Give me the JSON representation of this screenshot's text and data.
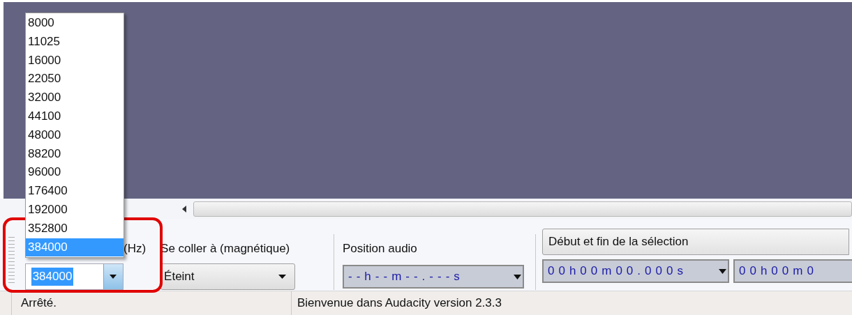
{
  "rate_dropdown": {
    "options": [
      {
        "label": "8000",
        "selected": false
      },
      {
        "label": "11025",
        "selected": false
      },
      {
        "label": "16000",
        "selected": false
      },
      {
        "label": "22050",
        "selected": false
      },
      {
        "label": "32000",
        "selected": false
      },
      {
        "label": "44100",
        "selected": false
      },
      {
        "label": "48000",
        "selected": false
      },
      {
        "label": "88200",
        "selected": false
      },
      {
        "label": "96000",
        "selected": false
      },
      {
        "label": "176400",
        "selected": false
      },
      {
        "label": "192000",
        "selected": false
      },
      {
        "label": "352800",
        "selected": false
      },
      {
        "label": "384000",
        "selected": true
      }
    ]
  },
  "toolbar": {
    "rate": {
      "label": "(Hz)",
      "value": "384000",
      "highlighted": true
    },
    "snap": {
      "label": "Se coller à (magnétique)",
      "value": "Éteint"
    },
    "position": {
      "label": "Position audio",
      "time": "--h--m--.---s"
    },
    "selection": {
      "mode": "Début et fin de la sélection",
      "start": "00h00m00.000s",
      "end": "00h00m0"
    }
  },
  "status_bar": {
    "state": "Arrêté.",
    "message": "Bienvenue dans Audacity version 2.3.3"
  }
}
